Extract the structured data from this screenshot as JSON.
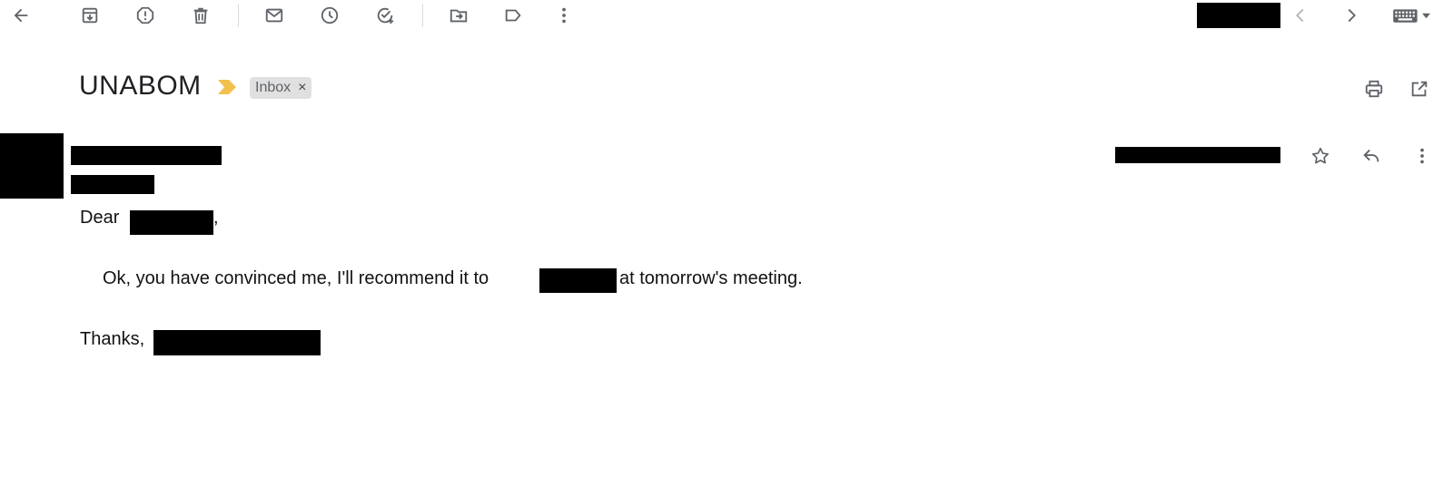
{
  "toolbar": {
    "back": "back-arrow-icon",
    "archive": "archive-icon",
    "report_spam": "report-spam-icon",
    "delete": "trash-icon",
    "mark_unread": "mail-icon",
    "snooze": "clock-icon",
    "add_task": "add-task-icon",
    "move_to": "move-to-folder-icon",
    "labels": "label-icon",
    "more": "more-vert-icon",
    "older": "chevron-left-icon",
    "newer": "chevron-right-icon",
    "input_tools": "keyboard-icon"
  },
  "message": {
    "subject": "UNABOM",
    "label_chip": "Inbox",
    "label_chip_close": "×"
  },
  "body": {
    "greeting": "Dear",
    "greeting_tail": ",",
    "line1_start": "Ok, you have convinced me, I'll recommend it to",
    "line1_end": "at tomorrow's meeting.",
    "signoff": "Thanks,"
  },
  "colors": {
    "important_marker": "#f2c04d",
    "chip_bg": "#e0e0e0",
    "icon": "#5f6368"
  }
}
